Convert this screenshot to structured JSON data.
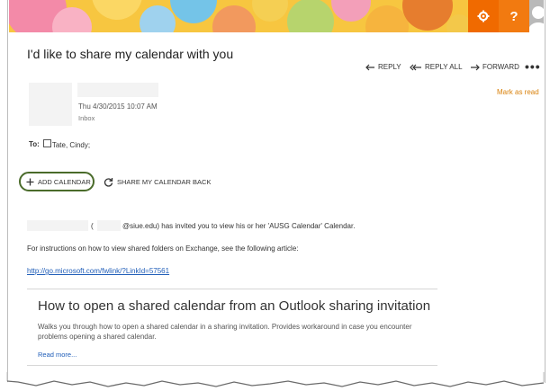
{
  "header": {
    "settings_icon": "gear-icon",
    "help_label": "?",
    "profile_icon": "avatar-icon"
  },
  "email": {
    "subject": "I'd like to share my calendar with you",
    "actions": {
      "reply": "REPLY",
      "reply_all": "REPLY ALL",
      "forward": "FORWARD",
      "more": "•••"
    },
    "mark_as_read": "Mark as read",
    "date": "Thu 4/30/2015 10:07 AM",
    "folder": "Inbox",
    "to_label": "To:",
    "to_value": "Tate, Cindy;",
    "add_calendar": "ADD CALENDAR",
    "share_back": "SHARE MY CALENDAR BACK",
    "invite_paren": "(",
    "invite_text": "@siue.edu) has invited you to view his or her 'AUSG Calendar' Calendar.",
    "instructions": "For instructions on how to view shared folders on Exchange, see the following article:",
    "link": "http://go.microsoft.com/fwlink/?LinkId=57561"
  },
  "preview_card": {
    "title": "How to open a shared calendar from an Outlook sharing invitation",
    "description": "Walks you through how to open a shared calendar in a sharing invitation. Provides workaround in case you encounter problems opening a shared calendar.",
    "read_more": "Read more..."
  },
  "colors": {
    "accent_orange": "#f06a00",
    "link_blue": "#1f5db8",
    "mark_read": "#d9820c",
    "add_calendar_border": "#4a6b2a"
  }
}
